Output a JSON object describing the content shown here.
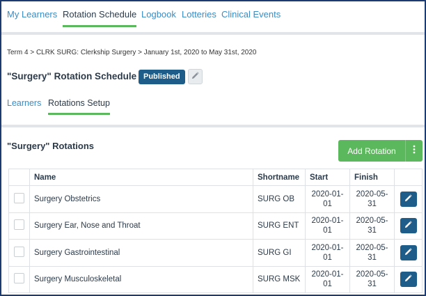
{
  "topnav": {
    "tabs": [
      {
        "label": "My Learners"
      },
      {
        "label": "Rotation Schedule"
      },
      {
        "label": "Logbook"
      },
      {
        "label": "Lotteries"
      },
      {
        "label": "Clinical Events"
      }
    ],
    "active_tab": "Rotation Schedule"
  },
  "breadcrumb": "Term 4 > CLRK SURG: Clerkship Surgery > January 1st, 2020 to May 31st, 2020",
  "header": {
    "title": "\"Surgery\" Rotation Schedule",
    "status_badge": "Published",
    "edit_icon": "pencil-icon"
  },
  "subtabs": {
    "items": [
      {
        "label": "Learners"
      },
      {
        "label": "Rotations Setup"
      }
    ],
    "active": "Rotations Setup"
  },
  "rotations": {
    "title": "\"Surgery\" Rotations",
    "add_button": "Add Rotation",
    "more_icon": "vertical-ellipsis-icon",
    "accent_color": "#5cb85c",
    "columns": [
      "Name",
      "Shortname",
      "Start",
      "Finish"
    ],
    "rows": [
      {
        "name": "Surgery Obstetrics",
        "shortname": "SURG OB",
        "start": "2020-01-01",
        "finish": "2020-05-31"
      },
      {
        "name": "Surgery Ear, Nose and Throat",
        "shortname": "SURG ENT",
        "start": "2020-01-01",
        "finish": "2020-05-31"
      },
      {
        "name": "Surgery Gastrointestinal",
        "shortname": "SURG GI",
        "start": "2020-01-01",
        "finish": "2020-05-31"
      },
      {
        "name": "Surgery Musculoskeletal",
        "shortname": "SURG MSK",
        "start": "2020-01-01",
        "finish": "2020-05-31"
      }
    ]
  },
  "colors": {
    "link": "#3a8cc4",
    "badge": "#1e5d8a",
    "edit_button": "#1e5d8a",
    "active_underline": "#5cb85c",
    "frame_border": "#1d3b73"
  }
}
